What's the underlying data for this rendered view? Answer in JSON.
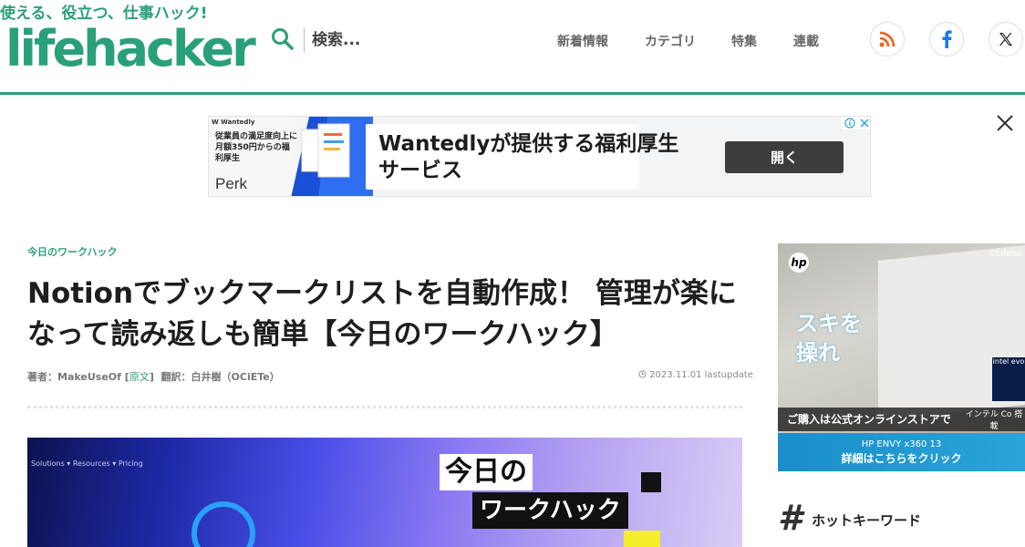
{
  "header": {
    "tagline": "使える、役立つ、仕事ハック!",
    "logo_text": "lifehacker",
    "search_placeholder": "検索...",
    "nav": [
      "新着情報",
      "カテゴリ",
      "特集",
      "連載"
    ],
    "social": [
      {
        "name": "rss",
        "icon": "rss-icon",
        "color": "#f26522"
      },
      {
        "name": "facebook",
        "icon": "facebook-icon",
        "color": "#1877f2"
      },
      {
        "name": "x",
        "icon": "x-icon",
        "color": "#111111"
      }
    ],
    "accent_color": "#2aa07a"
  },
  "banner_ad": {
    "brand": "W Wantedly",
    "small_copy": "従業員の満足度向上に月額350円からの福利厚生",
    "product": "Perk",
    "headline": "Wantedlyが提供する福利厚生サービス",
    "cta": "開く"
  },
  "article": {
    "category": "今日のワークハック",
    "title": "Notionでブックマークリストを自動作成！ 管理が楽になって読み返しも簡単【今日のワークハック】",
    "byline": {
      "author_label": "著者：",
      "author": "MakeUseOf",
      "original_open": "[",
      "original_link": "原文",
      "original_close": "]",
      "translator_label": "翻訳：",
      "translator": "白井樹（OCiETe）"
    },
    "date": "2023.11.01 lastupdate",
    "hero": {
      "label_1": "今日の",
      "label_2": "ワークハック",
      "nav_text": "Solutions ▾   Resources ▾   Pricing"
    }
  },
  "sidebar": {
    "ad": {
      "logo": "hp",
      "copyright": "©Lifeha",
      "headline_1": "スキを",
      "headline_2": "操れ",
      "badge": "intel evo",
      "shop_text": "ご購入は公式オンラインストアで",
      "shop_right": "インテル Co 搭載",
      "model": "HP ENVY x360 13",
      "cta": "詳細はこちらをクリック"
    },
    "hot_keywords_title": "ホットキーワード"
  }
}
